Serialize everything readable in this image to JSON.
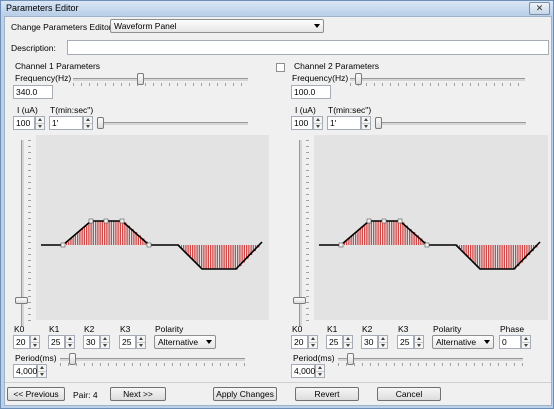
{
  "window": {
    "title": "Parameters Editor",
    "close_glyph": "✕"
  },
  "editor": {
    "label": "Change Parameters Editor:",
    "selected": "Waveform Panel"
  },
  "description": {
    "label": "Description:",
    "value": ""
  },
  "ch1": {
    "title": "Channel 1 Parameters",
    "freq_label": "Frequency(Hz)",
    "freq_value": "340.0",
    "freq_level": 0.38,
    "i_label": "I (uA)",
    "i_value": "100",
    "t_label": "T(min:sec\")",
    "t_value": "1'",
    "t_level": 0.0,
    "amp_level": 0.1,
    "k0_label": "K0",
    "k0_value": "20",
    "k1_label": "K1",
    "k1_value": "25",
    "k2_label": "K2",
    "k2_value": "30",
    "k3_label": "K3",
    "k3_value": "25",
    "polarity_label": "Polarity",
    "polarity_value": "Alternative",
    "period_label": "Period(ms)",
    "period_value": "4,000",
    "period_level": 0.05
  },
  "ch2": {
    "title": "Channel 2 Parameters",
    "enabled": false,
    "freq_label": "Frequency(Hz)",
    "freq_value": "100.0",
    "freq_level": 0.03,
    "i_label": "I (uA)",
    "i_value": "100",
    "t_label": "T(min:sec\")",
    "t_value": "1'",
    "t_level": 0.0,
    "amp_level": 0.1,
    "k0_label": "K0",
    "k0_value": "20",
    "k1_label": "K1",
    "k1_value": "25",
    "k2_label": "K2",
    "k2_value": "30",
    "k3_label": "K3",
    "k3_value": "25",
    "polarity_label": "Polarity",
    "polarity_value": "Alternative",
    "phase_label": "Phase",
    "phase_value": "0",
    "period_label": "Period(ms)",
    "period_value": "4,000",
    "period_level": 0.05
  },
  "footer": {
    "prev_label": "<< Previous",
    "pair_text": "Pair: 4",
    "next_label": "Next >>",
    "apply_label": "Apply Changes",
    "revert_label": "Revert",
    "cancel_label": "Cancel"
  },
  "colors": {
    "envelope": "#000000",
    "burst": "#d02020",
    "plot_bg": "#e3e3e3"
  }
}
